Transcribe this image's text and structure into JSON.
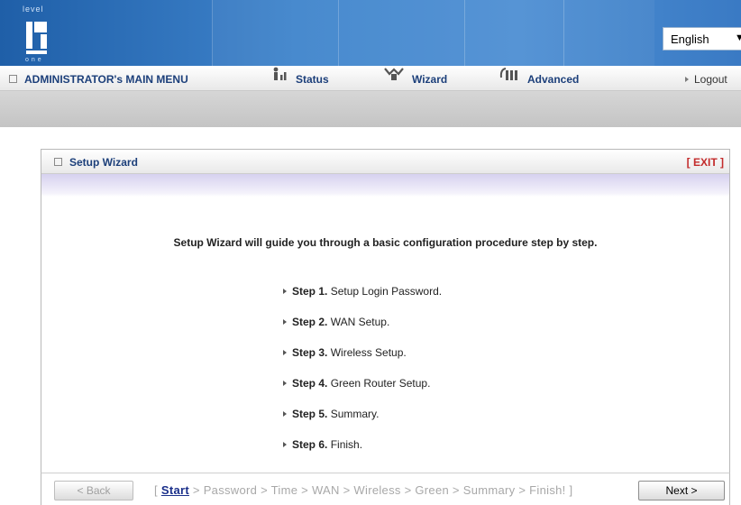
{
  "header": {
    "logo_text_top": "level",
    "logo_text_bottom": "one",
    "language": "English"
  },
  "menu": {
    "main_label": "ADMINISTRATOR's MAIN MENU",
    "status_label": "Status",
    "wizard_label": "Wizard",
    "advanced_label": "Advanced",
    "logout_label": "Logout"
  },
  "wizard": {
    "title": "Setup Wizard",
    "exit_label": "[ EXIT ]",
    "intro": "Setup Wizard will guide you through a basic configuration procedure step by step.",
    "steps": [
      {
        "step": "Step 1.",
        "text": "Setup Login Password."
      },
      {
        "step": "Step 2.",
        "text": "WAN Setup."
      },
      {
        "step": "Step 3.",
        "text": "Wireless Setup."
      },
      {
        "step": "Step 4.",
        "text": "Green Router Setup."
      },
      {
        "step": "Step 5.",
        "text": "Summary."
      },
      {
        "step": "Step 6.",
        "text": "Finish."
      }
    ]
  },
  "footer": {
    "back_label": "< Back",
    "next_label": "Next >",
    "crumb_open": "[",
    "crumb_current": "Start",
    "crumb_rest": "> Password > Time > WAN > Wireless > Green > Summary > Finish! ]"
  },
  "colors": {
    "banner": "#3f84cc",
    "menu_text": "#1c3f7a",
    "exit_red": "#c32b2b",
    "crumb_current": "#1a2f8a"
  }
}
